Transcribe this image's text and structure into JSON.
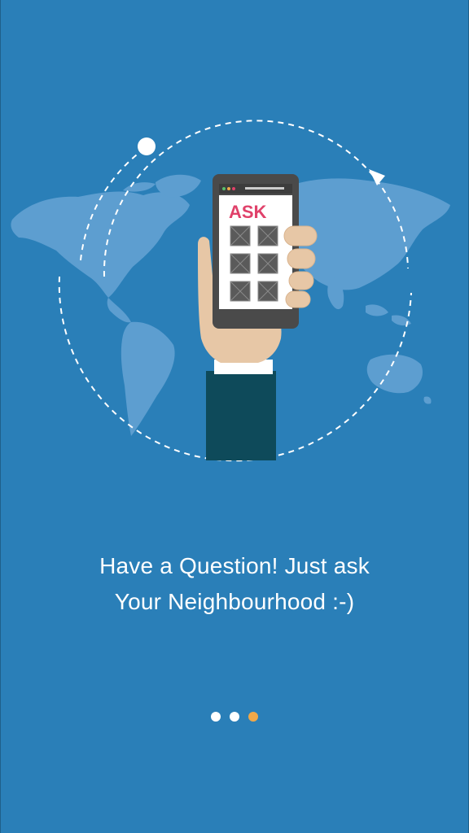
{
  "onboarding": {
    "caption_line1": "Have a Question! Just ask",
    "caption_line2": "Your Neighbourhood :-)",
    "phone_screen_label": "ASK",
    "illustration_icon": "hand-holding-phone-over-world-map",
    "pager": {
      "total": 3,
      "active_index": 2,
      "inactive_color": "#ffffff",
      "active_color": "#f0a848"
    }
  },
  "colors": {
    "background": "#2a7fb8",
    "map": "#5d9ed0",
    "accent_ask": "#e0416a",
    "sleeve": "#0e4a5a",
    "skin": "#e7c7a6"
  }
}
